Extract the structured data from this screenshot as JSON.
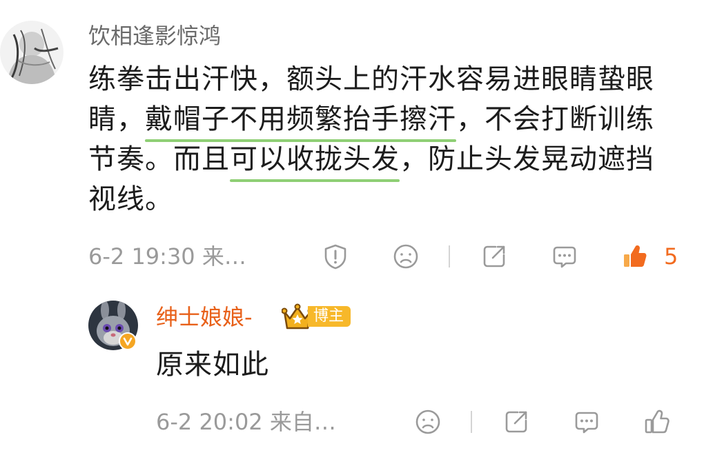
{
  "comment": {
    "username": "饮相逢影惊鸿",
    "text_parts": [
      "练拳击出汗快，额头上的汗水容易进眼睛蛰眼睛，",
      "戴帽子不用频繁抬手擦汗",
      "，不会打断训练节奏。而且",
      "可以收拢头发",
      "，防止头发晃动遮挡视线。"
    ],
    "timestamp": "6-2 19:30 来…",
    "like_count": "5",
    "icons": {
      "report": "report-icon",
      "dislike": "frown-face-icon",
      "share": "share-icon",
      "reply": "comment-icon",
      "like": "thumbs-up-icon"
    },
    "colors": {
      "highlight_underline": "#8fcf75",
      "like_active": "#f26b1f"
    }
  },
  "reply": {
    "username": "绅士娘娘-",
    "badge_label": "博主",
    "text": "原来如此",
    "timestamp": "6-2 20:02 来自…",
    "icons": {
      "dislike": "frown-face-icon",
      "share": "share-icon",
      "reply": "comment-icon",
      "like": "thumbs-up-icon"
    },
    "colors": {
      "username": "#e8611a",
      "badge": "#f7b82a",
      "verified": "#f5a623"
    }
  }
}
